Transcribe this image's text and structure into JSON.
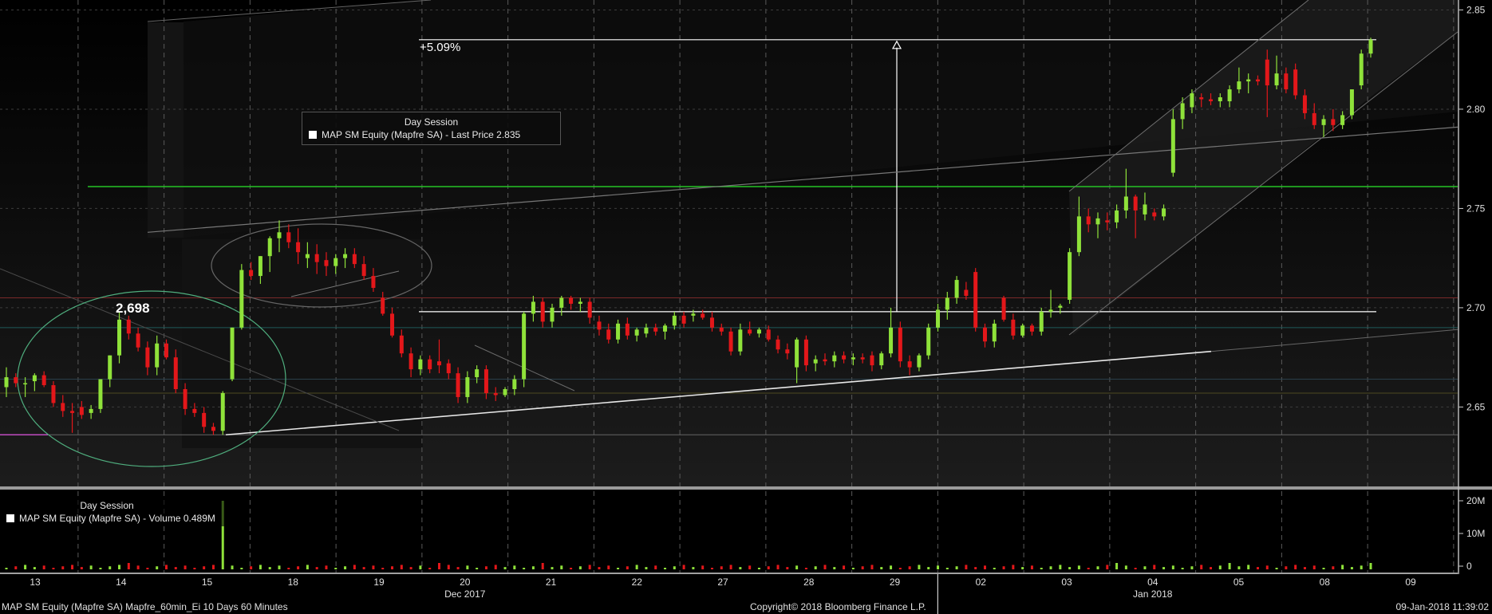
{
  "chart_data": {
    "type": "candlestick",
    "security": "MAP SM Equity (Mapfre SA)",
    "price_panel": {
      "legend_title": "Day Session",
      "legend_text": "MAP SM Equity (Mapfre SA) - Last Price 2.835",
      "ylim": [
        2.61,
        2.855
      ],
      "y_ticks": [
        2.65,
        2.7,
        2.75,
        2.8,
        2.85
      ],
      "y_tick_labels": [
        "2.65",
        "2.70",
        "2.75",
        "2.80",
        "2.85"
      ],
      "annotations": {
        "peak_label": "2,698",
        "peak_value": 2.698,
        "change_label": "+5.09%",
        "target_value": 2.835
      },
      "levels": {
        "green_resistance": 2.761,
        "base_line": 2.698
      }
    },
    "volume_panel": {
      "legend_title": "Day Session",
      "legend_text": "MAP SM Equity (Mapfre SA) - Volume 0.489M",
      "y_ticks": [
        0,
        10,
        20
      ],
      "y_tick_labels": [
        "0",
        "10M",
        "20M"
      ]
    },
    "x_tick_labels": [
      "13",
      "14",
      "15",
      "18",
      "19",
      "20",
      "21",
      "22",
      "27",
      "28",
      "29",
      "02",
      "03",
      "04",
      "05",
      "08",
      "09"
    ],
    "month_labels": [
      {
        "text": "Dec 2017",
        "after_tick": "20"
      },
      {
        "text": "Jan 2018",
        "after_tick": "04"
      }
    ],
    "colors": {
      "up": "#8fe23a",
      "down": "#e3171a",
      "green_line": "#25c325",
      "background": "#000000"
    },
    "candles": [
      {
        "o": 2.66,
        "h": 2.67,
        "l": 2.655,
        "c": 2.665
      },
      {
        "o": 2.665,
        "h": 2.667,
        "l": 2.66,
        "c": 2.662
      },
      {
        "o": 2.662,
        "h": 2.665,
        "l": 2.655,
        "c": 2.662
      },
      {
        "o": 2.663,
        "h": 2.667,
        "l": 2.658,
        "c": 2.666
      },
      {
        "o": 2.666,
        "h": 2.668,
        "l": 2.66,
        "c": 2.661
      },
      {
        "o": 2.661,
        "h": 2.663,
        "l": 2.65,
        "c": 2.652
      },
      {
        "o": 2.652,
        "h": 2.656,
        "l": 2.645,
        "c": 2.648
      },
      {
        "o": 2.648,
        "h": 2.652,
        "l": 2.637,
        "c": 2.647
      },
      {
        "o": 2.65,
        "h": 2.653,
        "l": 2.644,
        "c": 2.646
      },
      {
        "o": 2.647,
        "h": 2.651,
        "l": 2.644,
        "c": 2.649
      },
      {
        "o": 2.649,
        "h": 2.664,
        "l": 2.647,
        "c": 2.664
      },
      {
        "o": 2.664,
        "h": 2.676,
        "l": 2.66,
        "c": 2.676
      },
      {
        "o": 2.676,
        "h": 2.698,
        "l": 2.672,
        "c": 2.694
      },
      {
        "o": 2.694,
        "h": 2.696,
        "l": 2.684,
        "c": 2.687
      },
      {
        "o": 2.687,
        "h": 2.69,
        "l": 2.678,
        "c": 2.68
      },
      {
        "o": 2.68,
        "h": 2.683,
        "l": 2.666,
        "c": 2.67
      },
      {
        "o": 2.67,
        "h": 2.686,
        "l": 2.666,
        "c": 2.682
      },
      {
        "o": 2.682,
        "h": 2.684,
        "l": 2.674,
        "c": 2.675
      },
      {
        "o": 2.675,
        "h": 2.679,
        "l": 2.657,
        "c": 2.659
      },
      {
        "o": 2.659,
        "h": 2.662,
        "l": 2.646,
        "c": 2.649
      },
      {
        "o": 2.649,
        "h": 2.652,
        "l": 2.645,
        "c": 2.647
      },
      {
        "o": 2.647,
        "h": 2.65,
        "l": 2.637,
        "c": 2.64
      },
      {
        "o": 2.64,
        "h": 2.642,
        "l": 2.636,
        "c": 2.638
      },
      {
        "o": 2.638,
        "h": 2.658,
        "l": 2.636,
        "c": 2.657
      },
      {
        "o": 2.664,
        "h": 2.69,
        "l": 2.663,
        "c": 2.69
      },
      {
        "o": 2.69,
        "h": 2.722,
        "l": 2.689,
        "c": 2.719
      },
      {
        "o": 2.719,
        "h": 2.723,
        "l": 2.714,
        "c": 2.716
      },
      {
        "o": 2.716,
        "h": 2.726,
        "l": 2.712,
        "c": 2.726
      },
      {
        "o": 2.726,
        "h": 2.736,
        "l": 2.718,
        "c": 2.735
      },
      {
        "o": 2.735,
        "h": 2.744,
        "l": 2.728,
        "c": 2.738
      },
      {
        "o": 2.738,
        "h": 2.742,
        "l": 2.73,
        "c": 2.733
      },
      {
        "o": 2.733,
        "h": 2.74,
        "l": 2.722,
        "c": 2.728
      },
      {
        "o": 2.725,
        "h": 2.733,
        "l": 2.72,
        "c": 2.727
      },
      {
        "o": 2.727,
        "h": 2.732,
        "l": 2.717,
        "c": 2.723
      },
      {
        "o": 2.724,
        "h": 2.728,
        "l": 2.716,
        "c": 2.721
      },
      {
        "o": 2.721,
        "h": 2.727,
        "l": 2.717,
        "c": 2.725
      },
      {
        "o": 2.725,
        "h": 2.73,
        "l": 2.72,
        "c": 2.727
      },
      {
        "o": 2.727,
        "h": 2.73,
        "l": 2.72,
        "c": 2.722
      },
      {
        "o": 2.722,
        "h": 2.726,
        "l": 2.714,
        "c": 2.716
      },
      {
        "o": 2.716,
        "h": 2.72,
        "l": 2.708,
        "c": 2.71
      },
      {
        "o": 2.705,
        "h": 2.708,
        "l": 2.696,
        "c": 2.697
      },
      {
        "o": 2.697,
        "h": 2.7,
        "l": 2.685,
        "c": 2.686
      },
      {
        "o": 2.686,
        "h": 2.689,
        "l": 2.675,
        "c": 2.677
      },
      {
        "o": 2.677,
        "h": 2.68,
        "l": 2.665,
        "c": 2.669
      },
      {
        "o": 2.669,
        "h": 2.676,
        "l": 2.666,
        "c": 2.674
      },
      {
        "o": 2.674,
        "h": 2.676,
        "l": 2.667,
        "c": 2.669
      },
      {
        "o": 2.673,
        "h": 2.684,
        "l": 2.667,
        "c": 2.671
      },
      {
        "o": 2.672,
        "h": 2.674,
        "l": 2.664,
        "c": 2.667
      },
      {
        "o": 2.667,
        "h": 2.67,
        "l": 2.652,
        "c": 2.655
      },
      {
        "o": 2.655,
        "h": 2.668,
        "l": 2.652,
        "c": 2.665
      },
      {
        "o": 2.665,
        "h": 2.671,
        "l": 2.662,
        "c": 2.669
      },
      {
        "o": 2.669,
        "h": 2.671,
        "l": 2.654,
        "c": 2.657
      },
      {
        "o": 2.657,
        "h": 2.66,
        "l": 2.653,
        "c": 2.656
      },
      {
        "o": 2.656,
        "h": 2.66,
        "l": 2.655,
        "c": 2.659
      },
      {
        "o": 2.659,
        "h": 2.666,
        "l": 2.656,
        "c": 2.664
      },
      {
        "o": 2.664,
        "h": 2.698,
        "l": 2.66,
        "c": 2.697
      },
      {
        "o": 2.697,
        "h": 2.706,
        "l": 2.693,
        "c": 2.703
      },
      {
        "o": 2.703,
        "h": 2.705,
        "l": 2.69,
        "c": 2.693
      },
      {
        "o": 2.693,
        "h": 2.702,
        "l": 2.69,
        "c": 2.7
      },
      {
        "o": 2.7,
        "h": 2.706,
        "l": 2.696,
        "c": 2.705
      },
      {
        "o": 2.705,
        "h": 2.706,
        "l": 2.699,
        "c": 2.702
      },
      {
        "o": 2.702,
        "h": 2.705,
        "l": 2.698,
        "c": 2.703
      },
      {
        "o": 2.703,
        "h": 2.705,
        "l": 2.692,
        "c": 2.695
      },
      {
        "o": 2.693,
        "h": 2.696,
        "l": 2.686,
        "c": 2.689
      },
      {
        "o": 2.689,
        "h": 2.692,
        "l": 2.682,
        "c": 2.684
      },
      {
        "o": 2.684,
        "h": 2.694,
        "l": 2.682,
        "c": 2.692
      },
      {
        "o": 2.692,
        "h": 2.695,
        "l": 2.684,
        "c": 2.686
      },
      {
        "o": 2.686,
        "h": 2.69,
        "l": 2.683,
        "c": 2.689
      },
      {
        "o": 2.687,
        "h": 2.692,
        "l": 2.685,
        "c": 2.69
      },
      {
        "o": 2.69,
        "h": 2.692,
        "l": 2.686,
        "c": 2.688
      },
      {
        "o": 2.688,
        "h": 2.692,
        "l": 2.684,
        "c": 2.691
      },
      {
        "o": 2.691,
        "h": 2.698,
        "l": 2.689,
        "c": 2.696
      },
      {
        "o": 2.696,
        "h": 2.698,
        "l": 2.69,
        "c": 2.692
      },
      {
        "o": 2.696,
        "h": 2.699,
        "l": 2.693,
        "c": 2.697
      },
      {
        "o": 2.697,
        "h": 2.699,
        "l": 2.694,
        "c": 2.695
      },
      {
        "o": 2.695,
        "h": 2.698,
        "l": 2.688,
        "c": 2.69
      },
      {
        "o": 2.69,
        "h": 2.692,
        "l": 2.686,
        "c": 2.688
      },
      {
        "o": 2.688,
        "h": 2.69,
        "l": 2.676,
        "c": 2.678
      },
      {
        "o": 2.678,
        "h": 2.692,
        "l": 2.676,
        "c": 2.689
      },
      {
        "o": 2.689,
        "h": 2.693,
        "l": 2.686,
        "c": 2.687
      },
      {
        "o": 2.687,
        "h": 2.69,
        "l": 2.685,
        "c": 2.689
      },
      {
        "o": 2.689,
        "h": 2.691,
        "l": 2.683,
        "c": 2.684
      },
      {
        "o": 2.684,
        "h": 2.686,
        "l": 2.677,
        "c": 2.679
      },
      {
        "o": 2.679,
        "h": 2.682,
        "l": 2.674,
        "c": 2.677
      },
      {
        "o": 2.67,
        "h": 2.685,
        "l": 2.662,
        "c": 2.684
      },
      {
        "o": 2.684,
        "h": 2.686,
        "l": 2.668,
        "c": 2.671
      },
      {
        "o": 2.672,
        "h": 2.676,
        "l": 2.668,
        "c": 2.674
      },
      {
        "o": 2.674,
        "h": 2.677,
        "l": 2.671,
        "c": 2.673
      },
      {
        "o": 2.673,
        "h": 2.678,
        "l": 2.67,
        "c": 2.676
      },
      {
        "o": 2.676,
        "h": 2.678,
        "l": 2.672,
        "c": 2.674
      },
      {
        "o": 2.674,
        "h": 2.677,
        "l": 2.671,
        "c": 2.675
      },
      {
        "o": 2.675,
        "h": 2.677,
        "l": 2.672,
        "c": 2.674
      },
      {
        "o": 2.676,
        "h": 2.678,
        "l": 2.668,
        "c": 2.671
      },
      {
        "o": 2.671,
        "h": 2.678,
        "l": 2.669,
        "c": 2.677
      },
      {
        "o": 2.677,
        "h": 2.7,
        "l": 2.675,
        "c": 2.69
      },
      {
        "o": 2.69,
        "h": 2.693,
        "l": 2.67,
        "c": 2.673
      },
      {
        "o": 2.673,
        "h": 2.676,
        "l": 2.666,
        "c": 2.67
      },
      {
        "o": 2.67,
        "h": 2.677,
        "l": 2.668,
        "c": 2.676
      },
      {
        "o": 2.676,
        "h": 2.692,
        "l": 2.674,
        "c": 2.69
      },
      {
        "o": 2.69,
        "h": 2.702,
        "l": 2.688,
        "c": 2.699
      },
      {
        "o": 2.699,
        "h": 2.708,
        "l": 2.694,
        "c": 2.705
      },
      {
        "o": 2.705,
        "h": 2.716,
        "l": 2.702,
        "c": 2.714
      },
      {
        "o": 2.709,
        "h": 2.713,
        "l": 2.704,
        "c": 2.706
      },
      {
        "o": 2.718,
        "h": 2.72,
        "l": 2.688,
        "c": 2.69
      },
      {
        "o": 2.69,
        "h": 2.692,
        "l": 2.68,
        "c": 2.683
      },
      {
        "o": 2.683,
        "h": 2.694,
        "l": 2.68,
        "c": 2.692
      },
      {
        "o": 2.705,
        "h": 2.706,
        "l": 2.693,
        "c": 2.694
      },
      {
        "o": 2.694,
        "h": 2.697,
        "l": 2.684,
        "c": 2.686
      },
      {
        "o": 2.686,
        "h": 2.692,
        "l": 2.685,
        "c": 2.691
      },
      {
        "o": 2.691,
        "h": 2.692,
        "l": 2.686,
        "c": 2.688
      },
      {
        "o": 2.688,
        "h": 2.7,
        "l": 2.686,
        "c": 2.698
      },
      {
        "o": 2.698,
        "h": 2.709,
        "l": 2.695,
        "c": 2.699
      },
      {
        "o": 2.7,
        "h": 2.702,
        "l": 2.697,
        "c": 2.701
      },
      {
        "o": 2.704,
        "h": 2.73,
        "l": 2.702,
        "c": 2.728
      },
      {
        "o": 2.728,
        "h": 2.756,
        "l": 2.726,
        "c": 2.746
      },
      {
        "o": 2.746,
        "h": 2.75,
        "l": 2.738,
        "c": 2.742
      },
      {
        "o": 2.742,
        "h": 2.748,
        "l": 2.735,
        "c": 2.745
      },
      {
        "o": 2.744,
        "h": 2.748,
        "l": 2.739,
        "c": 2.743
      },
      {
        "o": 2.743,
        "h": 2.752,
        "l": 2.74,
        "c": 2.749
      },
      {
        "o": 2.749,
        "h": 2.77,
        "l": 2.745,
        "c": 2.756
      },
      {
        "o": 2.756,
        "h": 2.757,
        "l": 2.735,
        "c": 2.749
      },
      {
        "o": 2.747,
        "h": 2.758,
        "l": 2.744,
        "c": 2.752
      },
      {
        "o": 2.748,
        "h": 2.75,
        "l": 2.744,
        "c": 2.746
      },
      {
        "o": 2.746,
        "h": 2.752,
        "l": 2.744,
        "c": 2.75
      },
      {
        "o": 2.768,
        "h": 2.8,
        "l": 2.766,
        "c": 2.795
      },
      {
        "o": 2.795,
        "h": 2.806,
        "l": 2.79,
        "c": 2.803
      },
      {
        "o": 2.801,
        "h": 2.81,
        "l": 2.798,
        "c": 2.808
      },
      {
        "o": 2.806,
        "h": 2.808,
        "l": 2.801,
        "c": 2.805
      },
      {
        "o": 2.805,
        "h": 2.808,
        "l": 2.802,
        "c": 2.804
      },
      {
        "o": 2.804,
        "h": 2.808,
        "l": 2.801,
        "c": 2.806
      },
      {
        "o": 2.804,
        "h": 2.812,
        "l": 2.801,
        "c": 2.81
      },
      {
        "o": 2.81,
        "h": 2.821,
        "l": 2.808,
        "c": 2.814
      },
      {
        "o": 2.814,
        "h": 2.818,
        "l": 2.808,
        "c": 2.815
      },
      {
        "o": 2.815,
        "h": 2.817,
        "l": 2.812,
        "c": 2.814
      },
      {
        "o": 2.825,
        "h": 2.83,
        "l": 2.796,
        "c": 2.812
      },
      {
        "o": 2.812,
        "h": 2.827,
        "l": 2.81,
        "c": 2.818
      },
      {
        "o": 2.818,
        "h": 2.821,
        "l": 2.808,
        "c": 2.81
      },
      {
        "o": 2.82,
        "h": 2.823,
        "l": 2.805,
        "c": 2.807
      },
      {
        "o": 2.807,
        "h": 2.81,
        "l": 2.795,
        "c": 2.798
      },
      {
        "o": 2.798,
        "h": 2.803,
        "l": 2.79,
        "c": 2.792
      },
      {
        "o": 2.792,
        "h": 2.797,
        "l": 2.786,
        "c": 2.795
      },
      {
        "o": 2.795,
        "h": 2.8,
        "l": 2.789,
        "c": 2.792
      },
      {
        "o": 2.792,
        "h": 2.799,
        "l": 2.79,
        "c": 2.797
      },
      {
        "o": 2.797,
        "h": 2.81,
        "l": 2.795,
        "c": 2.81
      },
      {
        "o": 2.812,
        "h": 2.83,
        "l": 2.81,
        "c": 2.828
      },
      {
        "o": 2.828,
        "h": 2.836,
        "l": 2.826,
        "c": 2.835
      }
    ]
  },
  "footer": {
    "left": "MAP SM Equity (Mapfre SA) Mapfre_60min_Ei 10 Days 60 Minutes",
    "center": "Copyright© 2018 Bloomberg Finance L.P.",
    "right": "09-Jan-2018 11:39:02"
  }
}
